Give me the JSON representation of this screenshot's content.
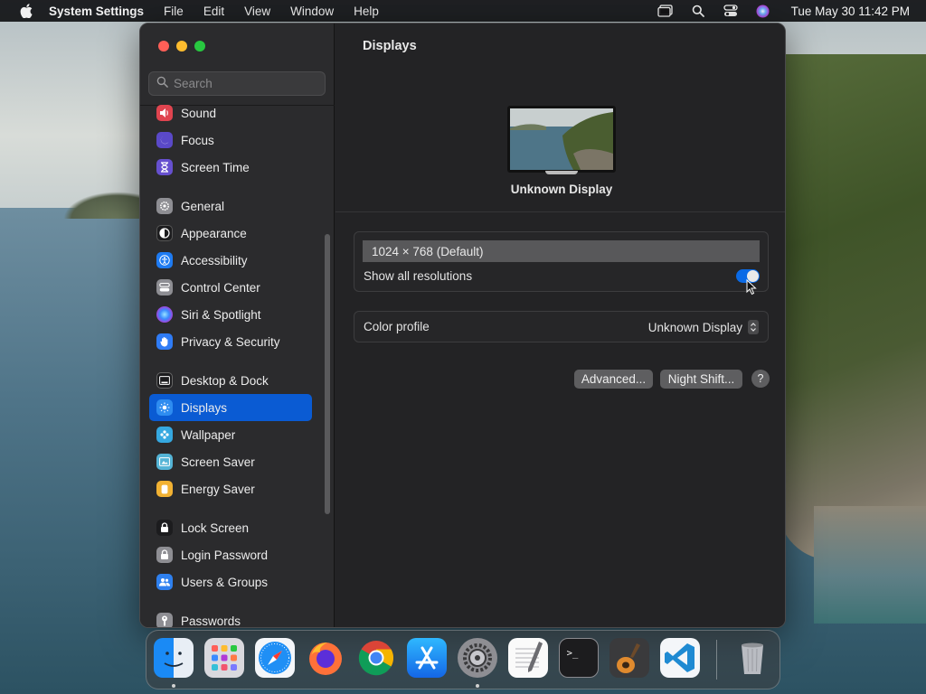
{
  "menubar": {
    "app_name": "System Settings",
    "menus": [
      "File",
      "Edit",
      "View",
      "Window",
      "Help"
    ],
    "clock": "Tue May 30  11:42 PM",
    "icons": [
      "window-icon",
      "search-icon",
      "control-center-icon",
      "siri-icon"
    ]
  },
  "sidebar": {
    "search_placeholder": "Search",
    "items": [
      {
        "label": "Sound",
        "icon": "speaker-icon",
        "color": "#e0444f"
      },
      {
        "label": "Focus",
        "icon": "moon-icon",
        "color": "#5a49c8"
      },
      {
        "label": "Screen Time",
        "icon": "hourglass-icon",
        "color": "#6650cf"
      },
      {
        "label": "General",
        "icon": "gear-icon",
        "color": "#8e8e93"
      },
      {
        "label": "Appearance",
        "icon": "appearance-icon",
        "color": "#1c1c1e"
      },
      {
        "label": "Accessibility",
        "icon": "accessibility-icon",
        "color": "#1e7bf2"
      },
      {
        "label": "Control Center",
        "icon": "control-center-icon",
        "color": "#8e8e93"
      },
      {
        "label": "Siri & Spotlight",
        "icon": "siri-icon",
        "color": "#b03ad6"
      },
      {
        "label": "Privacy & Security",
        "icon": "hand-icon",
        "color": "#2f7cf6"
      },
      {
        "label": "Desktop & Dock",
        "icon": "dock-icon",
        "color": "#1c1c1e"
      },
      {
        "label": "Displays",
        "icon": "sun-icon",
        "color": "#2e8cf0"
      },
      {
        "label": "Wallpaper",
        "icon": "flower-icon",
        "color": "#35a8e0"
      },
      {
        "label": "Screen Saver",
        "icon": "screen-saver-icon",
        "color": "#54b4d6"
      },
      {
        "label": "Energy Saver",
        "icon": "battery-icon",
        "color": "#f2b233"
      },
      {
        "label": "Lock Screen",
        "icon": "lock-icon",
        "color": "#1c1c1e"
      },
      {
        "label": "Login Password",
        "icon": "lock-icon",
        "color": "#8e8e93"
      },
      {
        "label": "Users & Groups",
        "icon": "users-icon",
        "color": "#2e80ef"
      },
      {
        "label": "Passwords",
        "icon": "key-icon",
        "color": "#8e8e93"
      }
    ],
    "active": "Displays"
  },
  "content": {
    "title": "Displays",
    "display_name": "Unknown Display",
    "resolution_selected": "1024 × 768 (Default)",
    "show_all_label": "Show all resolutions",
    "show_all_on": true,
    "color_profile_label": "Color profile",
    "color_profile_value": "Unknown Display",
    "advanced_button": "Advanced...",
    "night_shift_button": "Night Shift...",
    "help_button": "?"
  },
  "dock": {
    "apps": [
      "Finder",
      "Launchpad",
      "Safari",
      "Firefox",
      "Chrome",
      "App Store",
      "System Settings",
      "TextEdit",
      "Terminal",
      "GarageBand",
      "Visual Studio Code",
      "Trash"
    ]
  }
}
